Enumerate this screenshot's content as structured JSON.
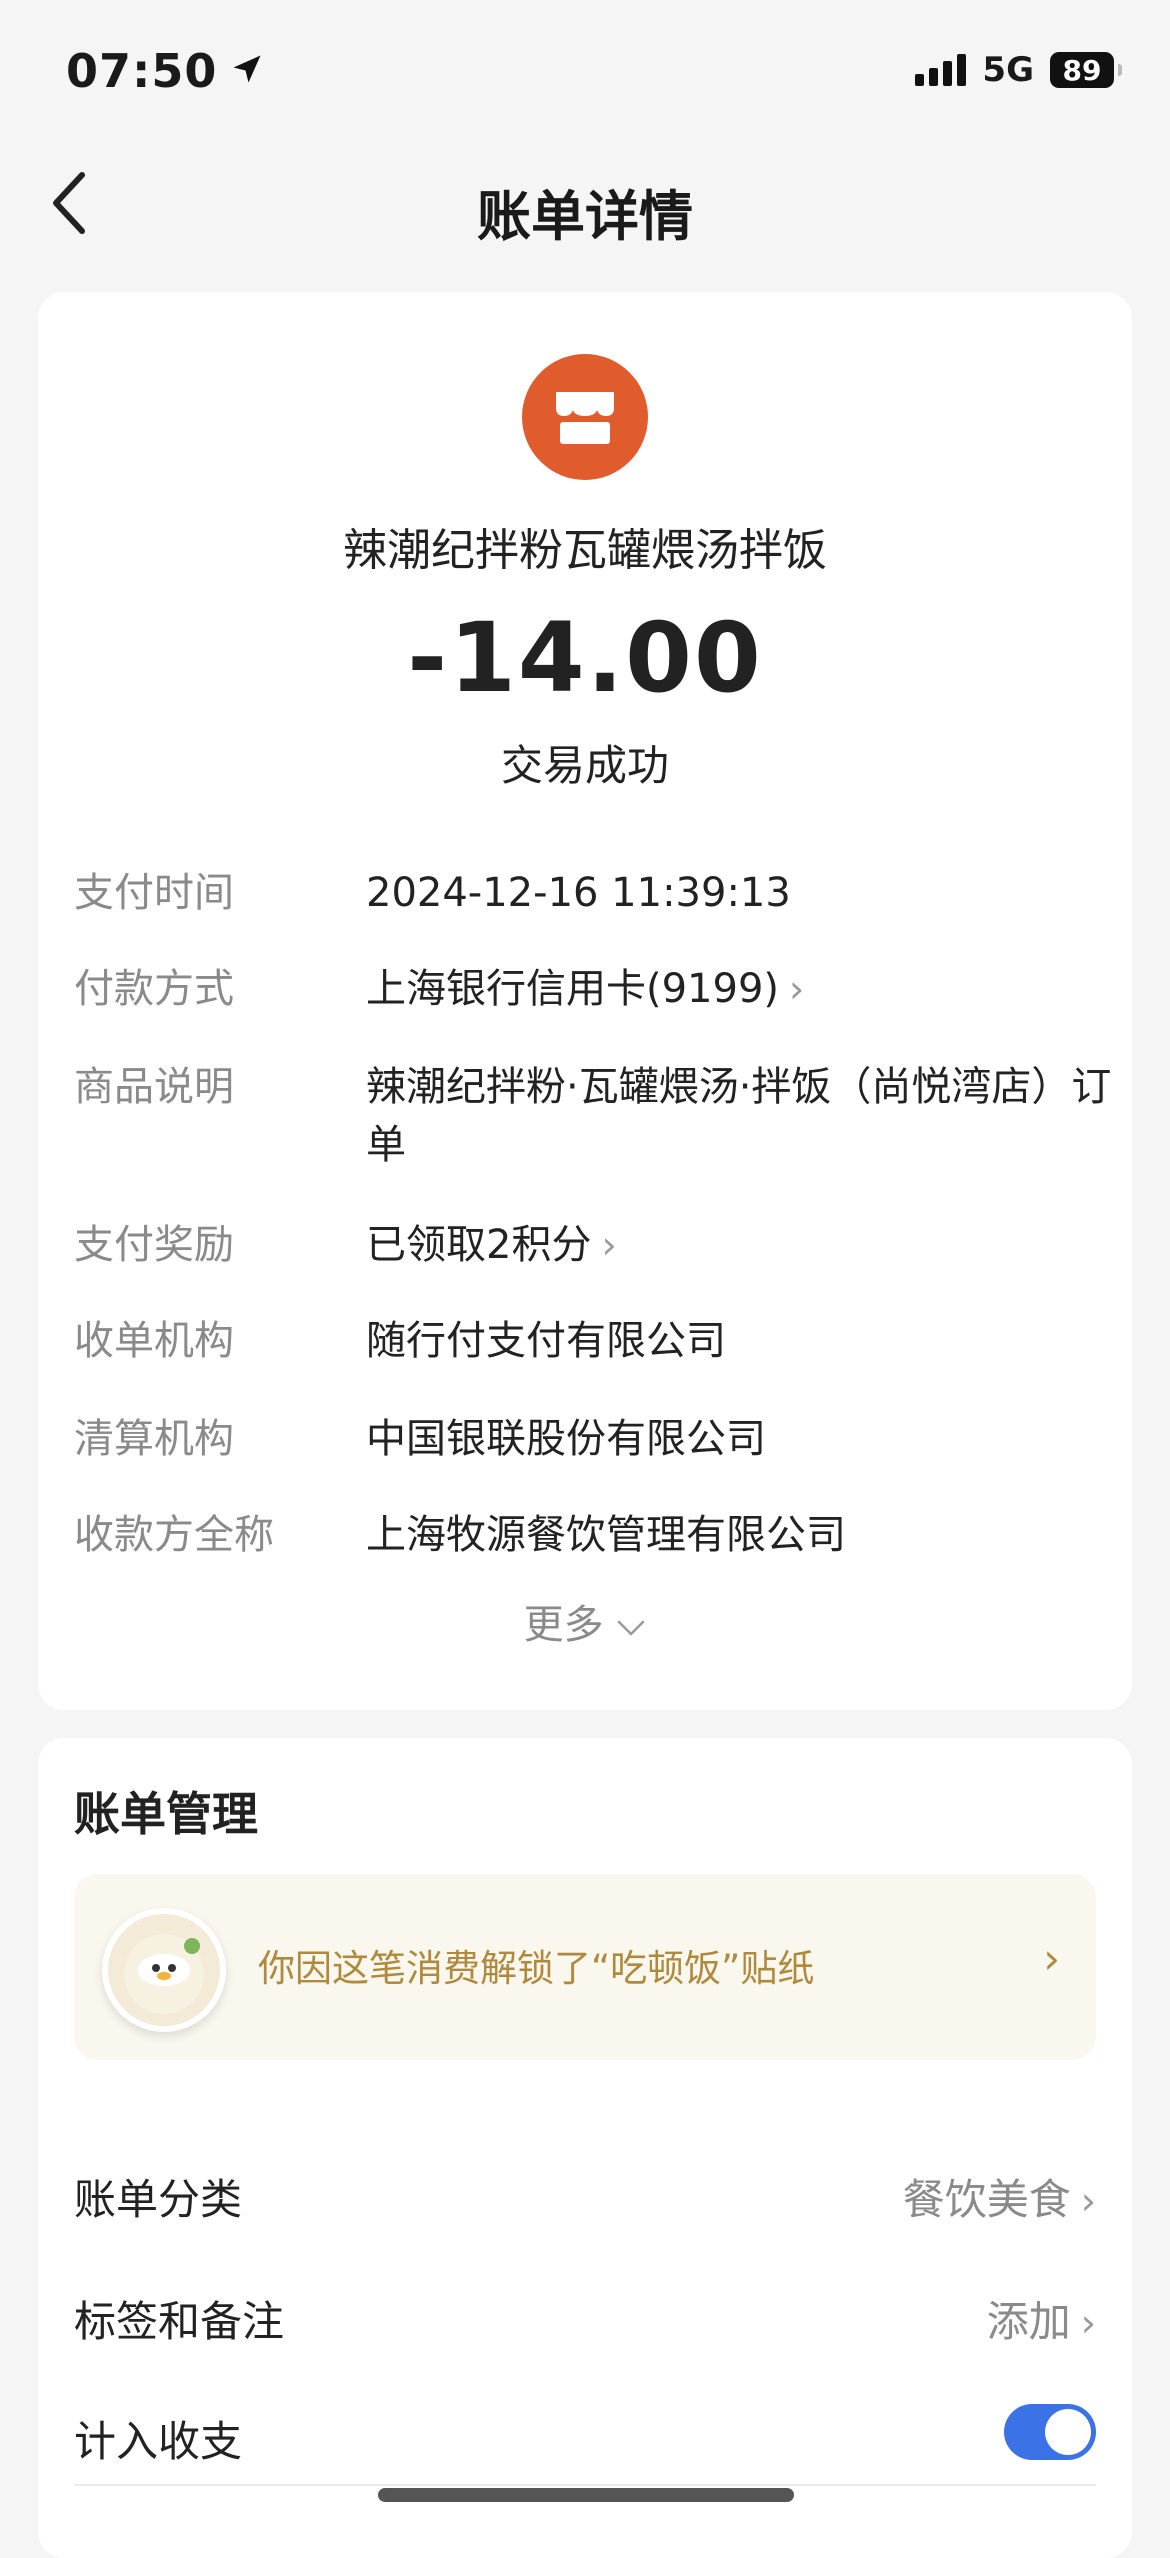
{
  "status_bar": {
    "time": "07:50",
    "network": "5G",
    "battery": "89"
  },
  "nav": {
    "title": "账单详情"
  },
  "bill": {
    "merchant_name": "辣潮纪拌粉瓦罐煨汤拌饭",
    "amount": "-14.00",
    "status": "交易成功",
    "brand_color": "#e05c2d",
    "details": [
      {
        "label": "支付时间",
        "value": "2024-12-16 11:39:13"
      },
      {
        "label": "付款方式",
        "value": "上海银行信用卡(9199)"
      },
      {
        "label": "商品说明",
        "value": "辣潮纪拌粉·瓦罐煨汤·拌饭（尚悦湾店）订单"
      },
      {
        "label": "支付奖励",
        "value": "已领取2积分"
      },
      {
        "label": "收单机构",
        "value": "随行付支付有限公司"
      },
      {
        "label": "清算机构",
        "value": "中国银联股份有限公司"
      },
      {
        "label": "收款方全称",
        "value": "上海牧源餐饮管理有限公司"
      }
    ],
    "more_label": "更多"
  },
  "management": {
    "title": "账单管理",
    "sticker_text": "你因这笔消费解锁了“吃顿饭”贴纸",
    "category_label": "账单分类",
    "category_value": "餐饮美食",
    "tags_label": "标签和备注",
    "tags_value": "添加",
    "include_label": "计入收支",
    "include_enabled": true,
    "toggle_color": "#3b73e6"
  },
  "icons": {
    "back": "chevron-left-icon",
    "location": "location-arrow-icon",
    "merchant": "shop-icon",
    "chevron": "chevron-right-icon",
    "expand": "chevron-down-icon"
  }
}
